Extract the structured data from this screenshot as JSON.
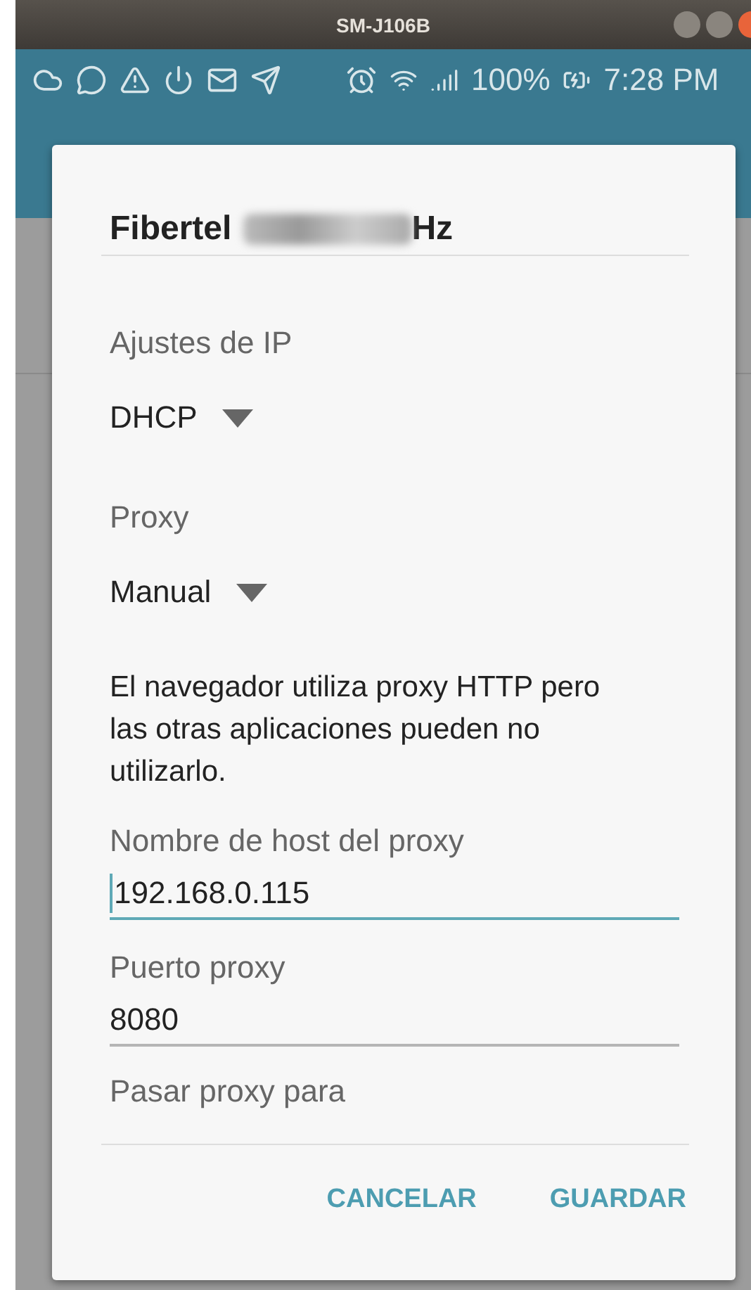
{
  "window": {
    "title": "SM-J106B"
  },
  "status_bar": {
    "battery": "100%",
    "time": "7:28 PM"
  },
  "dialog": {
    "title": "Fibertel",
    "title_tail": "Hz",
    "sections": [
      {
        "kind": "dropdown",
        "label": "Ajustes de IP",
        "value": "DHCP"
      },
      {
        "kind": "dropdown",
        "label": "Proxy",
        "value": "Manual"
      },
      {
        "kind": "note",
        "text": "El navegador utiliza proxy HTTP pero las otras aplicaciones pueden no utilizarlo."
      },
      {
        "kind": "field",
        "label": "Nombre de host del proxy",
        "value": "192.168.0.115",
        "focused": true
      },
      {
        "kind": "field",
        "label": "Puerto proxy",
        "value": "8080",
        "focused": false
      },
      {
        "kind": "label",
        "label": "Pasar proxy para"
      }
    ],
    "buttons": [
      "CANCELAR",
      "GUARDAR"
    ]
  }
}
